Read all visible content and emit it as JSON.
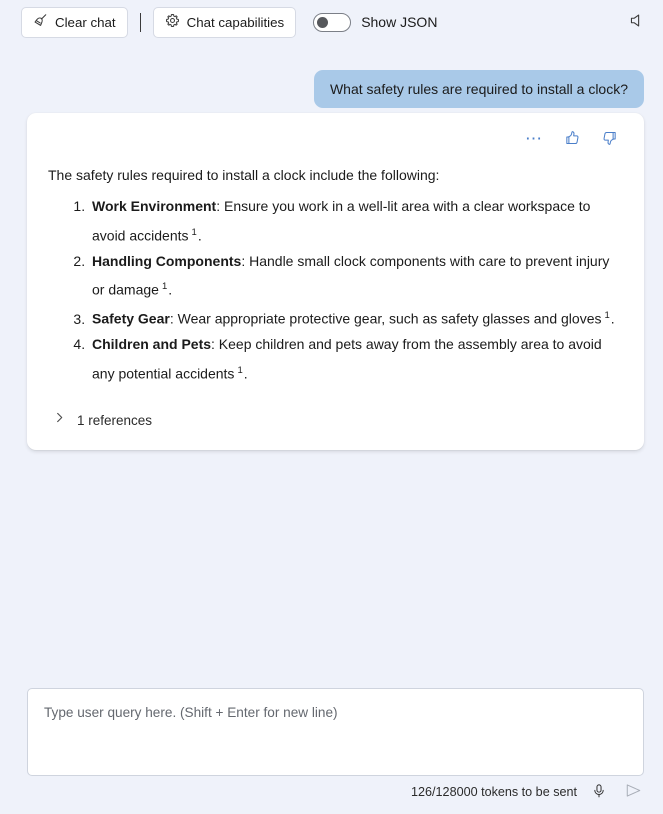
{
  "toolbar": {
    "clear_chat_label": "Clear chat",
    "clear_chat_icon": "broom-icon",
    "chat_capabilities_label": "Chat capabilities",
    "chat_capabilities_icon": "gear-icon",
    "show_json_label": "Show JSON",
    "show_json_state": "off",
    "speaker_icon": "speaker-mute-icon"
  },
  "conversation": {
    "user_message": "What safety rules are required to install a clock?",
    "assistant": {
      "actions": {
        "more_icon": "ellipsis-icon",
        "like_icon": "thumbs-up-icon",
        "dislike_icon": "thumbs-down-icon"
      },
      "intro": "The safety rules required to install a clock include the following:",
      "items": [
        {
          "title": "Work Environment",
          "text": ": Ensure you work in a well-lit area with a clear workspace to avoid accidents",
          "citation": "1",
          "trailing": "."
        },
        {
          "title": "Handling Components",
          "text": ": Handle small clock components with care to prevent injury or damage",
          "citation": "1",
          "trailing": "."
        },
        {
          "title": "Safety Gear",
          "text": ": Wear appropriate protective gear, such as safety glasses and gloves",
          "citation": "1",
          "trailing": "."
        },
        {
          "title": "Children and Pets",
          "text": ": Keep children and pets away from the assembly area to avoid any potential accidents",
          "citation": "1",
          "trailing": "."
        }
      ],
      "references_label": "1 references",
      "references_expanded": false,
      "references_icon": "chevron-right-icon"
    }
  },
  "composer": {
    "placeholder": "Type user query here. (Shift + Enter for new line)",
    "value": "",
    "token_status": "126/128000 tokens to be sent",
    "mic_icon": "microphone-icon",
    "send_icon": "send-icon"
  },
  "colors": {
    "background": "#eff2fa",
    "card": "#ffffff",
    "user_bubble": "#a9c9e8",
    "accent": "#4a7ec9",
    "text": "#1b1b1b"
  }
}
